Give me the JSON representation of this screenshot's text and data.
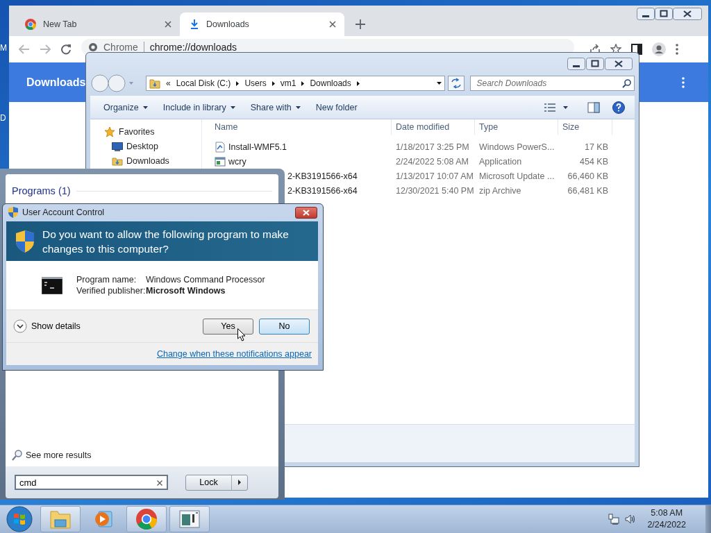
{
  "desktop": {
    "icon_labels": [
      "M",
      "D"
    ]
  },
  "chrome": {
    "tabs": [
      {
        "label": "New Tab",
        "selected": false,
        "kind": "newtab"
      },
      {
        "label": "Downloads",
        "selected": true,
        "kind": "downloads"
      }
    ],
    "omnibox": {
      "site": "Chrome",
      "url": "chrome://downloads"
    },
    "page_title": "Downloads"
  },
  "explorer": {
    "breadcrumb_overflow": "«",
    "breadcrumb": [
      "Local Disk (C:)",
      "Users",
      "vm1",
      "Downloads"
    ],
    "search": {
      "placeholder": "Search Downloads"
    },
    "toolbar": [
      {
        "label": "Organize",
        "dropdown": true
      },
      {
        "label": "Include in library",
        "dropdown": true
      },
      {
        "label": "Share with",
        "dropdown": true
      },
      {
        "label": "New folder",
        "dropdown": false
      }
    ],
    "nav": {
      "heading": "Favorites",
      "items": [
        {
          "label": "Desktop",
          "kind": "desktop"
        },
        {
          "label": "Downloads",
          "kind": "downloads"
        }
      ]
    },
    "columns": [
      "Name",
      "Date modified",
      "Type",
      "Size"
    ],
    "rows": [
      {
        "kind": "script",
        "name": "Install-WMF5.1",
        "date": "1/18/2017 3:25 PM",
        "type": "Windows PowerS...",
        "size": "17 KB"
      },
      {
        "kind": "application",
        "name": "wcry",
        "date": "2/24/2022 5:08 AM",
        "type": "Application",
        "size": "454 KB"
      },
      {
        "kind": "partial",
        "name": "2-KB3191566-x64",
        "date": "1/13/2017 10:07 AM",
        "type": "Microsoft Update ...",
        "size": "66,460 KB"
      },
      {
        "kind": "partial",
        "name": "2-KB3191566-x64",
        "date": "12/30/2021 5:40 PM",
        "type": "zip Archive",
        "size": "66,481 KB"
      }
    ]
  },
  "start_menu": {
    "section": "Programs (1)",
    "see_more": "See more results",
    "search": {
      "value": "cmd"
    },
    "power_button": "Lock"
  },
  "uac": {
    "title": "User Account Control",
    "question": "Do you want to allow the following program to make changes to this computer?",
    "details": [
      {
        "label": "Program name:",
        "value": "Windows Command Processor",
        "bold": false
      },
      {
        "label": "Verified publisher:",
        "value": "Microsoft Windows",
        "bold": true
      }
    ],
    "show_details": "Show details",
    "buttons": [
      {
        "label": "Yes",
        "default": false
      },
      {
        "label": "No",
        "default": true
      }
    ],
    "link": "Change when these notifications appear"
  },
  "taskbar": {
    "items": [
      {
        "kind": "explorer",
        "running": true
      },
      {
        "kind": "media",
        "running": false
      },
      {
        "kind": "chrome",
        "running": true
      },
      {
        "kind": "app",
        "running": true
      }
    ],
    "time": "5:08 AM",
    "date": "2/24/2022"
  }
}
